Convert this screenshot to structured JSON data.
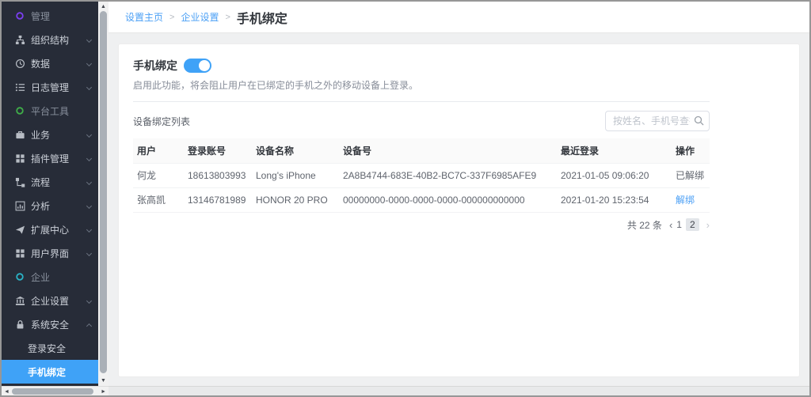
{
  "colors": {
    "accent_blue": "#3fa2f7",
    "link_blue": "#4a9ff5",
    "sidebar_bg": "#272c38",
    "section_purple": "#7b3ff2",
    "section_green": "#3fae49",
    "section_teal": "#2ab3c6"
  },
  "sidebar": {
    "items": [
      {
        "name": "management",
        "label": "管理",
        "icon": "ring-icon",
        "icon_color": "#7b3ff2",
        "type": "section"
      },
      {
        "name": "org-structure",
        "label": "组织结构",
        "icon": "sitemap-icon",
        "type": "item",
        "chevron": "down"
      },
      {
        "name": "data",
        "label": "数据",
        "icon": "clock-icon",
        "type": "item",
        "chevron": "down"
      },
      {
        "name": "log-management",
        "label": "日志管理",
        "icon": "list-icon",
        "type": "item",
        "chevron": "down"
      },
      {
        "name": "platform-tools",
        "label": "平台工具",
        "icon": "ring-icon",
        "icon_color": "#3fae49",
        "type": "section"
      },
      {
        "name": "business",
        "label": "业务",
        "icon": "briefcase-icon",
        "type": "item",
        "chevron": "down"
      },
      {
        "name": "plugin-management",
        "label": "插件管理",
        "icon": "grid-icon",
        "type": "item",
        "chevron": "down"
      },
      {
        "name": "workflow",
        "label": "流程",
        "icon": "flow-icon",
        "type": "item",
        "chevron": "down"
      },
      {
        "name": "analysis",
        "label": "分析",
        "icon": "chart-icon",
        "type": "item",
        "chevron": "down"
      },
      {
        "name": "extension-center",
        "label": "扩展中心",
        "icon": "send-icon",
        "type": "item",
        "chevron": "down"
      },
      {
        "name": "user-interface",
        "label": "用户界面",
        "icon": "grid-icon",
        "type": "item",
        "chevron": "down"
      },
      {
        "name": "enterprise",
        "label": "企业",
        "icon": "ring-icon",
        "icon_color": "#2ab3c6",
        "type": "section"
      },
      {
        "name": "enterprise-settings",
        "label": "企业设置",
        "icon": "building-icon",
        "type": "item",
        "chevron": "down"
      },
      {
        "name": "system-security",
        "label": "系统安全",
        "icon": "lock-icon",
        "type": "item",
        "chevron": "up"
      },
      {
        "name": "login-security",
        "label": "登录安全",
        "type": "subitem",
        "active": false
      },
      {
        "name": "phone-binding",
        "label": "手机绑定",
        "type": "subitem",
        "active": true
      }
    ]
  },
  "breadcrumb": {
    "links": [
      "设置主页",
      "企业设置"
    ],
    "separator": ">",
    "current": "手机绑定"
  },
  "toggle_section": {
    "title": "手机绑定",
    "enabled": true,
    "description": "启用此功能，将会阻止用户在已绑定的手机之外的移动设备上登录。"
  },
  "device_list": {
    "title": "设备绑定列表",
    "search_placeholder": "按姓名、手机号查找用户",
    "columns": [
      "用户",
      "登录账号",
      "设备名称",
      "设备号",
      "最近登录",
      "操作"
    ],
    "rows": [
      {
        "user": "何龙",
        "account": "18613803993",
        "device_name": "Long's iPhone",
        "device_id": "2A8B4744-683E-40B2-BC7C-337F6985AFE9",
        "last_login": "2021-01-05 09:06:20",
        "action": "已解绑",
        "action_type": "text"
      },
      {
        "user": "张高凯",
        "account": "13146781989",
        "device_name": "HONOR 20 PRO",
        "device_id": "00000000-0000-0000-0000-000000000000",
        "last_login": "2021-01-20 15:23:54",
        "action": "解绑",
        "action_type": "link"
      }
    ],
    "pagination": {
      "total_text": "共 22 条",
      "pages": [
        "1",
        "2"
      ],
      "current_page": "2"
    }
  }
}
